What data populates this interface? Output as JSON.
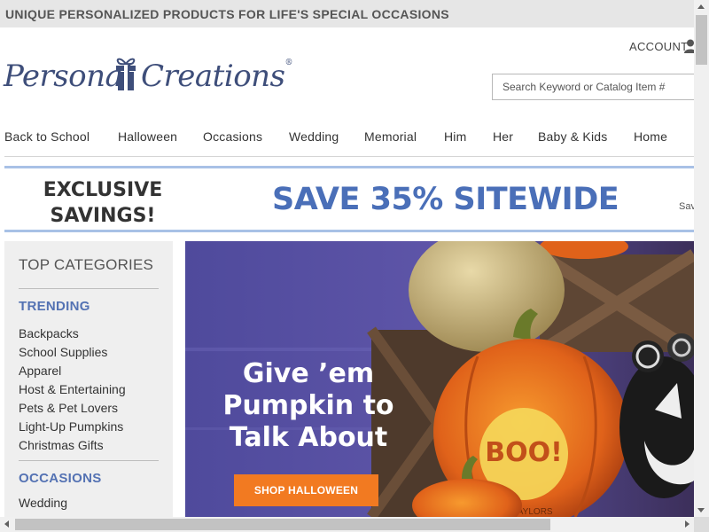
{
  "topbar": {
    "text": "UNIQUE PERSONALIZED PRODUCTS FOR LIFE'S SPECIAL OCCASIONS"
  },
  "header": {
    "account_label": "ACCOUNT",
    "logo_text": "Personal Creations",
    "logo_mark": "®",
    "search_placeholder": "Search Keyword or Catalog Item #"
  },
  "nav": {
    "items": [
      "Back to School",
      "Halloween",
      "Occasions",
      "Wedding",
      "Memorial",
      "Him",
      "Her",
      "Baby & Kids",
      "Home"
    ]
  },
  "promo": {
    "left_line1": "EXCLUSIVE",
    "left_line2": "SAVINGS!",
    "main": "SAVE 35% SITEWIDE",
    "right": "Sav"
  },
  "sidebar": {
    "title": "TOP CATEGORIES",
    "trending_heading": "TRENDING",
    "trending_items": [
      "Backpacks",
      "School Supplies",
      "Apparel",
      "Host & Entertaining",
      "Pets & Pet Lovers",
      "Light-Up Pumpkins",
      "Christmas Gifts"
    ],
    "occasions_heading": "OCCASIONS",
    "occasions_first": "Wedding"
  },
  "hero": {
    "line1": "Give ’em",
    "line2": "Pumpkin to",
    "line3": "Talk About",
    "button": "SHOP HALLOWEEN",
    "pumpkin_text": "BOO!",
    "pumpkin_name": "TAYLORS"
  },
  "colors": {
    "brand_blue": "#4a6fb8",
    "heading_blue": "#5472b3",
    "cta_orange": "#f27a21",
    "promo_border": "#a8c1e6",
    "hero_purple": "#5a4f9e"
  },
  "icons": [
    "user-icon",
    "gift-icon",
    "chevron-up-icon",
    "chevron-down-icon",
    "chevron-left-icon",
    "chevron-right-icon"
  ]
}
